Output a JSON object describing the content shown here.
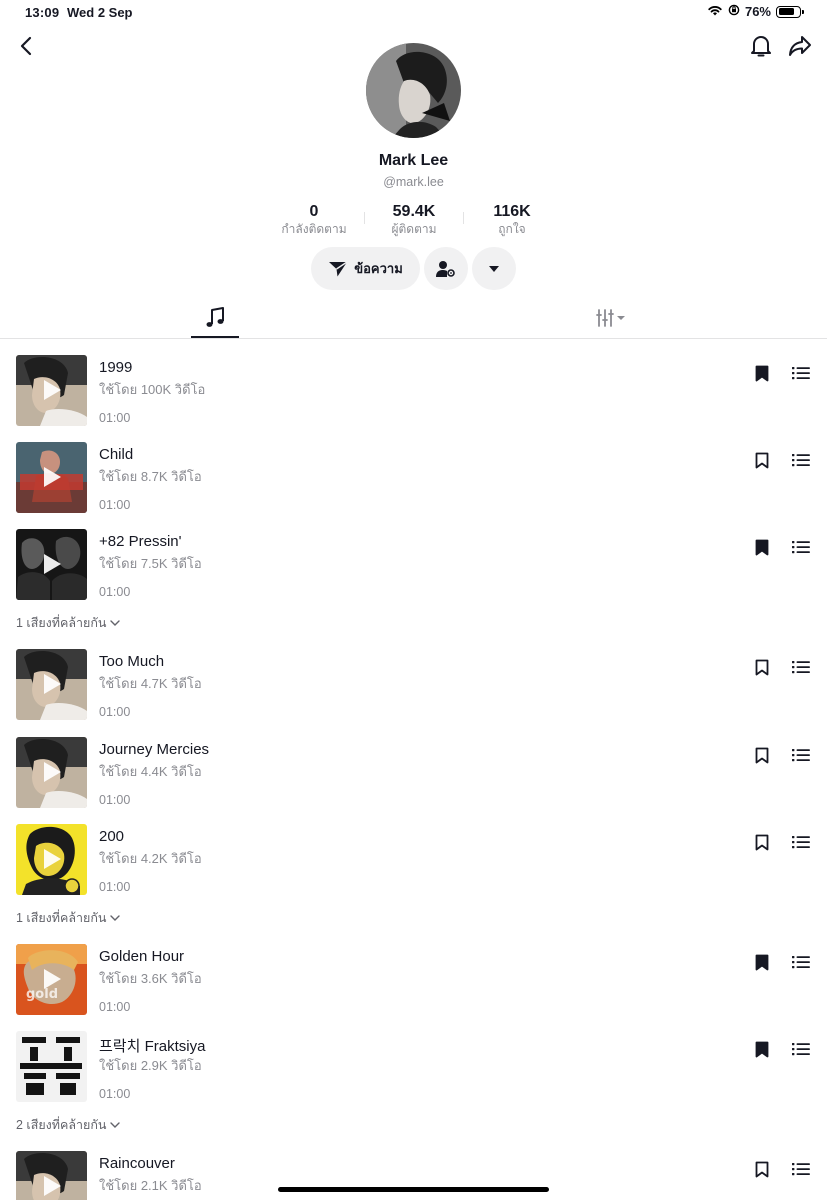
{
  "status_bar": {
    "time": "13:09",
    "date": "Wed 2 Sep",
    "battery": "76%"
  },
  "profile": {
    "name": "Mark Lee",
    "handle": "@mark.lee"
  },
  "stats": [
    {
      "value": "0",
      "label": "กำลังติดตาม"
    },
    {
      "value": "59.4K",
      "label": "ผู้ติดตาม"
    },
    {
      "value": "116K",
      "label": "ถูกใจ"
    }
  ],
  "actions": {
    "message_label": "ข้อความ"
  },
  "tabs": [
    {
      "icon": "music-note-icon",
      "active": true
    },
    {
      "icon": "filter-bars-icon",
      "active": false
    }
  ],
  "sounds": [
    {
      "title": "1999",
      "meta": "ใช้โดย 100K วิดีโอ",
      "duration": "01:00",
      "saved": true
    },
    {
      "title": "Child",
      "meta": "ใช้โดย 8.7K วิดีโอ",
      "duration": "01:00",
      "saved": false
    },
    {
      "title": "+82 Pressin'",
      "meta": "ใช้โดย 7.5K วิดีโอ",
      "duration": "01:00",
      "saved": true
    },
    {
      "title": "Too Much",
      "meta": "ใช้โดย 4.7K วิดีโอ",
      "duration": "01:00",
      "saved": false
    },
    {
      "title": "Journey Mercies",
      "meta": "ใช้โดย 4.4K วิดีโอ",
      "duration": "01:00",
      "saved": false
    },
    {
      "title": "200",
      "meta": "ใช้โดย 4.2K วิดีโอ",
      "duration": "01:00",
      "saved": false
    },
    {
      "title": "Golden Hour",
      "meta": "ใช้โดย 3.6K วิดีโอ",
      "duration": "01:00",
      "saved": true
    },
    {
      "title": "프락치 Fraktsiya",
      "meta": "ใช้โดย 2.9K วิดีโอ",
      "duration": "01:00",
      "saved": true
    },
    {
      "title": "Raincouver",
      "meta": "ใช้โดย 2.1K วิดีโอ",
      "duration": "",
      "saved": false
    }
  ],
  "similar_labels": [
    "1 เสียงที่คล้ายกัน",
    "1 เสียงที่คล้ายกัน",
    "2 เสียงที่คล้ายกัน"
  ]
}
